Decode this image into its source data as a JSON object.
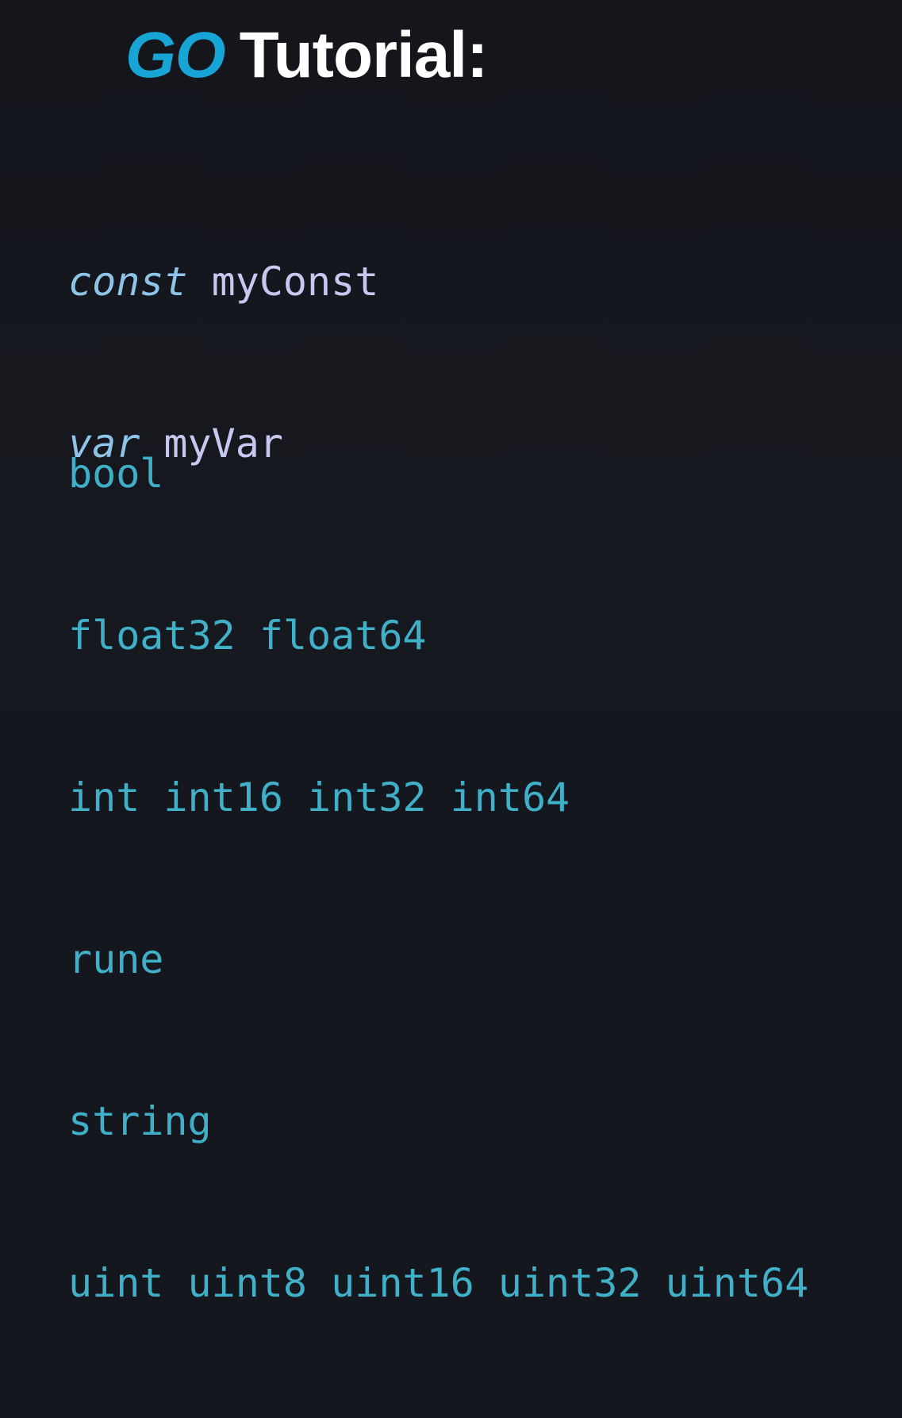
{
  "title": {
    "highlight": "GO",
    "rest": "Tutorial:"
  },
  "declarations": [
    {
      "keyword": "const",
      "name": "myConst"
    },
    {
      "keyword": "var",
      "name": "myVar"
    }
  ],
  "types": [
    "bool",
    "float32 float64",
    "int int16 int32 int64",
    "rune",
    "string",
    "uint uint8 uint16 uint32 uint64"
  ],
  "colors": {
    "background": "#15171e",
    "go_blue": "#17a5d6",
    "keyword": "#8ec4e8",
    "identifier": "#c6c8f0",
    "type": "#3fb0c8"
  }
}
